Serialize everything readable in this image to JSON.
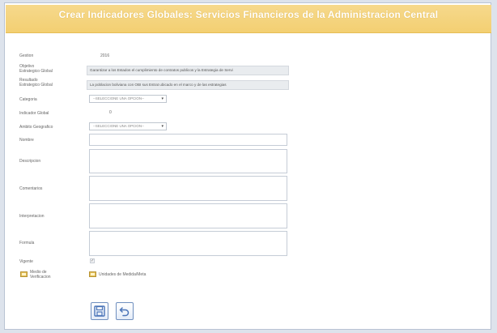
{
  "header": {
    "title": "Crear Indicadores Globales: Servicios Financieros de la Administracion Central"
  },
  "form": {
    "gestion": {
      "label": "Gestion",
      "value": "2016"
    },
    "objetivo": {
      "label": "Objetivo Estrategico Global",
      "value": "Garantizar a los Estados el cumplimiento de contratos publicos y la Estrategia de Servi"
    },
    "resultado": {
      "label": "Resultado Estrategico Global",
      "value": "La poblacion boliviana con OBI sus Estrat ubicado en el marco y de las estrategias"
    },
    "categoria": {
      "label": "Categoria",
      "placeholder": "--SELECCIONE UNA OPCION--"
    },
    "indicador": {
      "label": "Indicador Global",
      "value": "0"
    },
    "ambito": {
      "label": "Ambito Geografico",
      "placeholder": "--SELECCIONE UNA OPCION--"
    },
    "nombre": {
      "label": "Nombre"
    },
    "descripcion": {
      "label": "Descripcion"
    },
    "comentarios": {
      "label": "Comentarios"
    },
    "interpretacion": {
      "label": "Interpretacion"
    },
    "formula": {
      "label": "Formula"
    },
    "vigente": {
      "label": "Vigente"
    }
  },
  "attachments": {
    "medio": {
      "label": "Medio de Verificacion"
    },
    "unidades": {
      "label": "Unidades de Medida/Meta"
    }
  },
  "buttons": {
    "save": {
      "icon": "save-icon"
    },
    "back": {
      "icon": "undo-icon"
    }
  },
  "colors": {
    "header": "#f3d27a",
    "accent": "#4a74b8"
  }
}
